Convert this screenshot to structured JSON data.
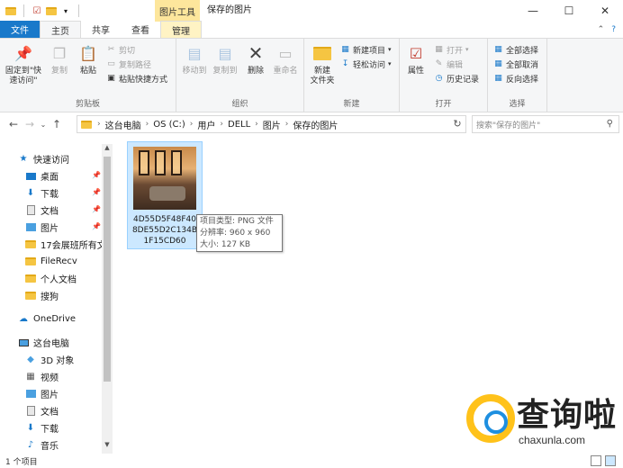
{
  "window": {
    "title": "保存的图片",
    "tool_tab": "图片工具"
  },
  "tabs": [
    "文件",
    "主页",
    "共享",
    "查看",
    "管理"
  ],
  "ribbon": {
    "clipboard": {
      "label": "剪贴板",
      "pin": "固定到\"快速访问\"",
      "copy": "复制",
      "paste": "粘贴",
      "cut": "剪切",
      "copy_path": "复制路径",
      "paste_shortcut": "粘贴快捷方式"
    },
    "organize": {
      "label": "组织",
      "move_to": "移动到",
      "copy_to": "复制到",
      "delete": "删除",
      "rename": "重命名"
    },
    "new": {
      "label": "新建",
      "new_folder": "新建\n文件夹",
      "new_item": "新建项目",
      "easy_access": "轻松访问"
    },
    "open": {
      "label": "打开",
      "properties": "属性",
      "open": "打开",
      "edit": "编辑",
      "history": "历史记录"
    },
    "select": {
      "label": "选择",
      "select_all": "全部选择",
      "select_none": "全部取消",
      "invert": "反向选择"
    }
  },
  "address": {
    "crumbs": [
      "这台电脑",
      "OS (C:)",
      "用户",
      "DELL",
      "图片",
      "保存的图片"
    ],
    "search_placeholder": "搜索\"保存的图片\""
  },
  "sidebar": {
    "quick_access": "快速访问",
    "items": [
      "桌面",
      "下载",
      "文档",
      "图片",
      "17会展班所有文",
      "FileRecv",
      "个人文档",
      "搜狗"
    ],
    "onedrive": "OneDrive",
    "this_pc": "这台电脑",
    "pc_items": [
      "3D 对象",
      "视频",
      "图片",
      "文档",
      "下载",
      "音乐"
    ]
  },
  "file": {
    "name": "4D55D5F48F408DE55D2C134B1F15CD60",
    "name_lines": [
      "4D55D5F48F40",
      "8DE55D2C134B",
      "1F15CD60"
    ]
  },
  "tooltip": {
    "type": "项目类型: PNG 文件",
    "resolution": "分辨率: 960 x 960",
    "size": "大小: 127 KB"
  },
  "status": {
    "count": "1 个项目"
  },
  "watermark": {
    "text": "查询啦",
    "url": "chaxunla.com"
  }
}
